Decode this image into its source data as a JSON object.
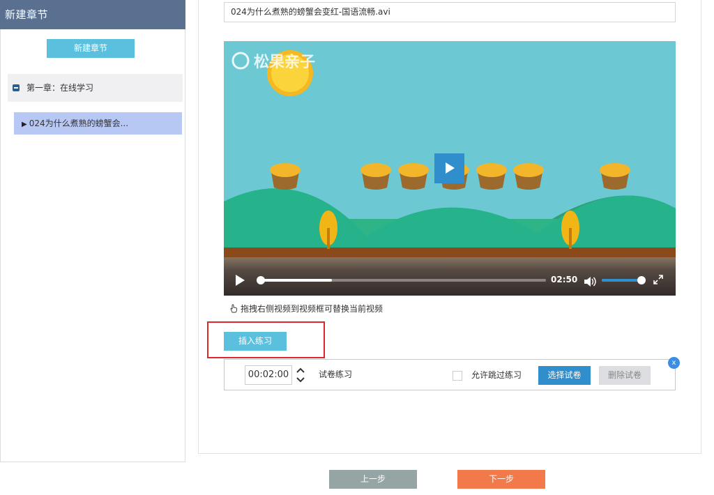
{
  "sidebar": {
    "title": "新建章节",
    "new_chapter_button": "新建章节",
    "chapter_label": "第一章：在线学习",
    "lesson_label": "024为什么煮熟的螃蟹会..."
  },
  "main": {
    "filename": "024为什么煮熟的螃蟹会变红-国语流畅.avi",
    "video": {
      "watermark": "松果亲子",
      "time": "02:50",
      "progress_fraction": 0.0,
      "buffered_fraction": 0.25,
      "volume_fraction": 0.95
    },
    "hint": "拖拽右侧视频到视频框可替换当前视频",
    "insert_exercise_button": "插入练习",
    "exercise": {
      "time_value": "00:02:00",
      "type_label": "试卷练习",
      "allow_skip_label": "允许跳过练习",
      "allow_skip_checked": false,
      "choose_button": "选择试卷",
      "delete_button": "删除试卷",
      "close_label": "x"
    }
  },
  "footer": {
    "prev_button": "上一步",
    "next_button": "下一步"
  },
  "colors": {
    "sidebar_header": "#5a7090",
    "accent_light_blue": "#5bc0de",
    "accent_blue": "#2f8ecb",
    "lesson_selected": "#b8c8f5",
    "next_orange": "#f27a4a",
    "prev_gray": "#95a5a6",
    "highlight_red": "#e0262b"
  },
  "icons": {
    "collapse": "minus-square-icon",
    "lesson_arrow": "play-arrow-icon",
    "hand": "hand-pointer-icon",
    "volume": "volume-icon",
    "fullscreen": "fullscreen-icon"
  }
}
